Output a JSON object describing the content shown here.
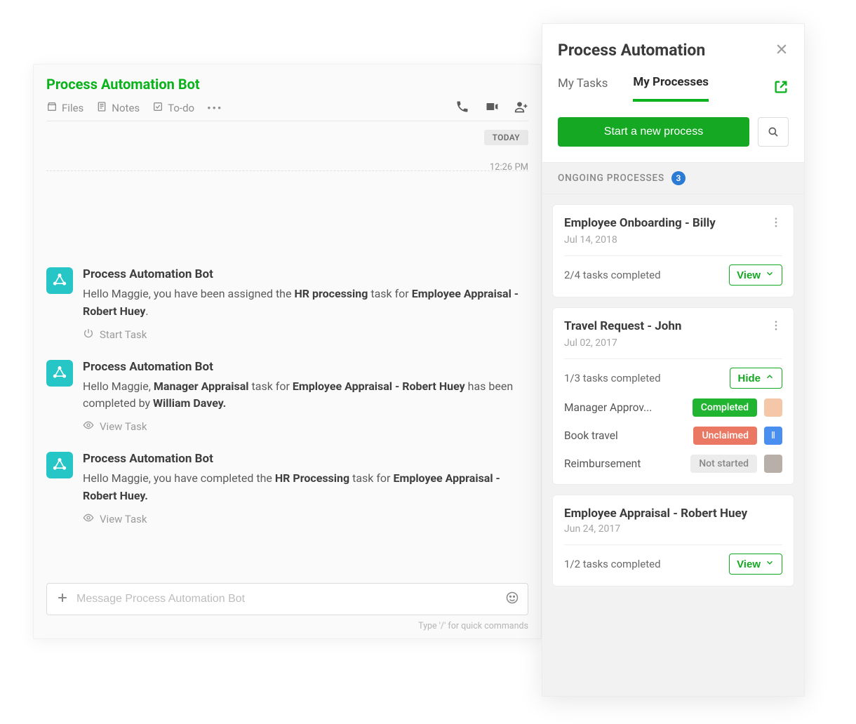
{
  "chat": {
    "title": "Process Automation Bot",
    "tabs": {
      "files": "Files",
      "notes": "Notes",
      "todo": "To-do"
    },
    "dateChip": "TODAY",
    "timestamp": "12:26 PM",
    "inputPlaceholder": "Message Process Automation Bot",
    "footerHint": "Type '/' for quick commands",
    "messages": [
      {
        "sender": "Process Automation Bot",
        "pre": "Hello Maggie, you have been assigned the ",
        "b1": "HR processing",
        "mid": " task for ",
        "b2": "Employee Appraisal - Robert Huey",
        "post": ".",
        "action": "Start Task",
        "actionIcon": "power"
      },
      {
        "sender": "Process Automation Bot",
        "pre": "Hello Maggie, ",
        "b1": "Manager Appraisal",
        "mid": " task for ",
        "b2": "Employee Appraisal - Robert Huey",
        "post2": " has been completed by ",
        "b3": "William Davey.",
        "action": "View Task",
        "actionIcon": "eye"
      },
      {
        "sender": "Process Automation Bot",
        "pre": "Hello Maggie, you have completed the ",
        "b1": "HR Processing",
        "mid": " task for ",
        "b2": "Employee Appraisal - Robert Huey.",
        "action": "View Task",
        "actionIcon": "eye"
      }
    ]
  },
  "panel": {
    "title": "Process Automation",
    "tabs": {
      "mytasks": "My Tasks",
      "myprocesses": "My Processes"
    },
    "startBtn": "Start a new process",
    "sectionLabel": "ONGOING PROCESSES",
    "sectionCount": "3",
    "cards": [
      {
        "title": "Employee Onboarding - Billy",
        "date": "Jul 14, 2018",
        "progress": "2/4 tasks completed",
        "toggle": "View",
        "toggleDir": "down"
      },
      {
        "title": "Travel Request - John",
        "date": "Jul 02, 2017",
        "progress": "1/3 tasks completed",
        "toggle": "Hide",
        "toggleDir": "up",
        "tasks": [
          {
            "name": "Manager Approv...",
            "status": "Completed",
            "statusClass": "completed",
            "assigneeClass": "peach"
          },
          {
            "name": "Book travel",
            "status": "Unclaimed",
            "statusClass": "unclaimed",
            "assigneeClass": "blue",
            "assigneeGlyph": "⦀"
          },
          {
            "name": "Reimbursement",
            "status": "Not started",
            "statusClass": "notstarted",
            "assigneeClass": "gray"
          }
        ]
      },
      {
        "title": "Employee Appraisal - Robert Huey",
        "date": "Jun 24, 2017",
        "progress": "1/2 tasks completed",
        "toggle": "View",
        "toggleDir": "down"
      }
    ]
  }
}
